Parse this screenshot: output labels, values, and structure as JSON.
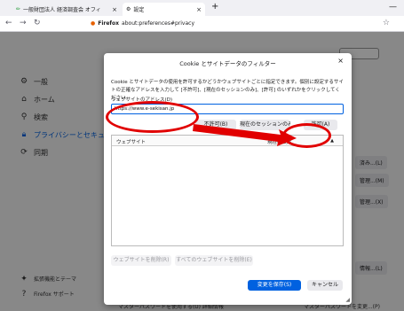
{
  "browser": {
    "tabs": [
      {
        "title": "一般財団法人 経済調査会 オフィ"
      },
      {
        "title": "設定"
      }
    ],
    "url_brand": "Firefox",
    "url": "about:preferences#privacy"
  },
  "sidebar": {
    "items": [
      {
        "label": "一般",
        "icon": "gear-icon"
      },
      {
        "label": "ホーム",
        "icon": "home-icon"
      },
      {
        "label": "検索",
        "icon": "search-icon"
      },
      {
        "label": "プライバシーとセキュリティ",
        "icon": "lock-icon"
      },
      {
        "label": "同期",
        "icon": "sync-icon"
      }
    ],
    "bottom": [
      {
        "label": "拡張機能とテーマ",
        "icon": "puzzle-icon"
      },
      {
        "label": "Firefox サポート",
        "icon": "help-icon"
      }
    ]
  },
  "background": {
    "right_buttons": [
      "済み...(L)",
      "管理...(M)",
      "管理...(X)",
      "情報...(L)"
    ],
    "bottom_left": "マスターパスワードを使用する(U)  詳細情報",
    "bottom_right": "マスターパスワードを変更...(P)"
  },
  "dialog": {
    "title": "Cookie とサイトデータのフィルター",
    "description": "Cookie とサイトデータの使用を許可するかどうかウェブサイトごとに指定できます。個別に設定するサイトの正確なアドレスを入力して [不許可]、[現在のセッションのみ]、[許可] のいずれかをクリックしてください。",
    "address_label": "ウェブサイトのアドレス(D)",
    "address_value": "https://www.e-sekisan.jp",
    "block_label": "不許可(B)",
    "session_label": "現在のセッションのみ(S)",
    "allow_label": "許可(A)",
    "col_site": "ウェブサイト",
    "col_status": "現在の設定",
    "remove_label": "ウェブサイトを削除(R)",
    "remove_all_label": "すべてのウェブサイトを削除(E)",
    "save_label": "変更を保存(S)",
    "cancel_label": "キャンセル"
  },
  "colors": {
    "accent": "#0061e0",
    "annotation": "#e10000"
  }
}
